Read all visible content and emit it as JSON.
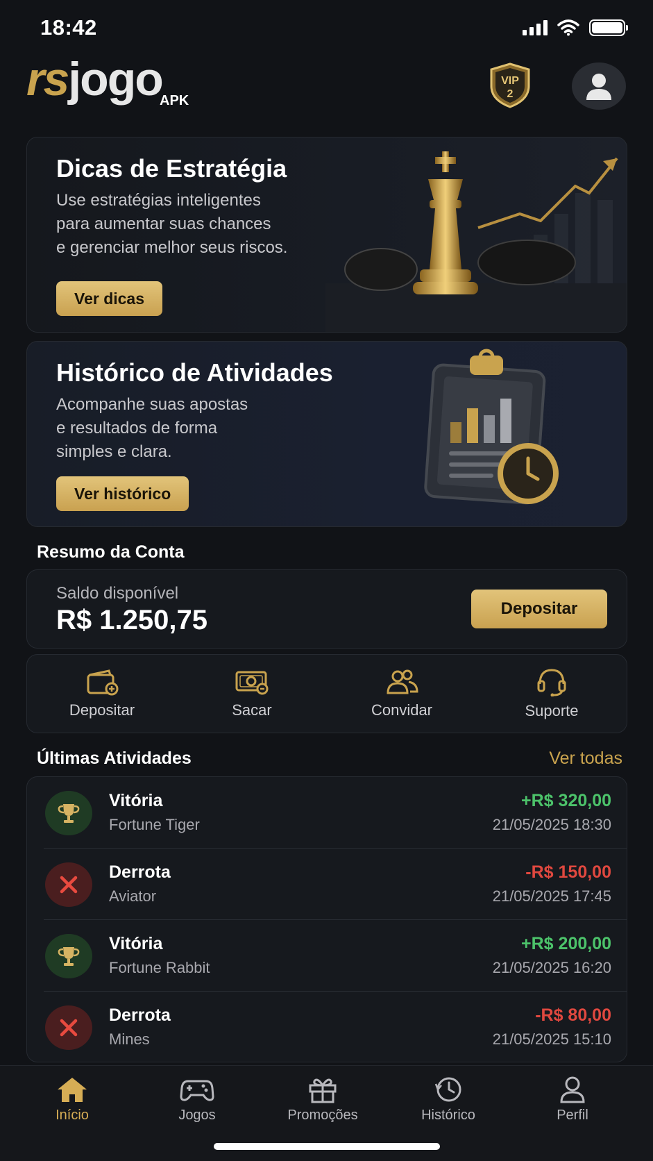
{
  "status_bar": {
    "time": "18:42"
  },
  "header": {
    "logo_rs": "rs",
    "logo_jogo": "jogo",
    "logo_sub": "APK",
    "vip_label": "VIP",
    "vip_level": "2"
  },
  "promos": [
    {
      "title": "Dicas de Estratégia",
      "description_lines": [
        "Use estratégias inteligentes",
        "para aumentar suas chances",
        "e gerenciar melhor seus riscos."
      ],
      "button": "Ver dicas"
    },
    {
      "title": "Histórico de Atividades",
      "description_lines": [
        "Acompanhe suas apostas",
        "e resultados de forma",
        "simples e clara."
      ],
      "button": "Ver histórico"
    }
  ],
  "account": {
    "section_title": "Resumo da Conta",
    "balance_label": "Saldo disponível",
    "balance_value": "R$ 1.250,75",
    "deposit_button": "Depositar"
  },
  "quick_actions": [
    {
      "label": "Depositar",
      "icon": "wallet-plus-icon"
    },
    {
      "label": "Sacar",
      "icon": "cash-withdraw-icon"
    },
    {
      "label": "Convidar",
      "icon": "users-icon"
    },
    {
      "label": "Suporte",
      "icon": "headset-icon"
    }
  ],
  "activities": {
    "section_title": "Últimas Atividades",
    "see_all": "Ver todas",
    "items": [
      {
        "result": "Vitória",
        "game": "Fortune Tiger",
        "amount": "+R$ 320,00",
        "datetime": "21/05/2025 18:30",
        "type": "win"
      },
      {
        "result": "Derrota",
        "game": "Aviator",
        "amount": "-R$ 150,00",
        "datetime": "21/05/2025 17:45",
        "type": "loss"
      },
      {
        "result": "Vitória",
        "game": "Fortune Rabbit",
        "amount": "+R$ 200,00",
        "datetime": "21/05/2025 16:20",
        "type": "win"
      },
      {
        "result": "Derrota",
        "game": "Mines",
        "amount": "-R$ 80,00",
        "datetime": "21/05/2025 15:10",
        "type": "loss"
      }
    ]
  },
  "bottom_nav": [
    {
      "label": "Início",
      "icon": "home-icon",
      "active": true
    },
    {
      "label": "Jogos",
      "icon": "gamepad-icon",
      "active": false
    },
    {
      "label": "Promoções",
      "icon": "gift-icon",
      "active": false
    },
    {
      "label": "Histórico",
      "icon": "clock-icon",
      "active": false
    },
    {
      "label": "Perfil",
      "icon": "user-icon",
      "active": false
    }
  ],
  "colors": {
    "accent_gold": "#c9a34e",
    "win_green": "#4cc26a",
    "loss_red": "#e0483f",
    "background": "#111317"
  }
}
